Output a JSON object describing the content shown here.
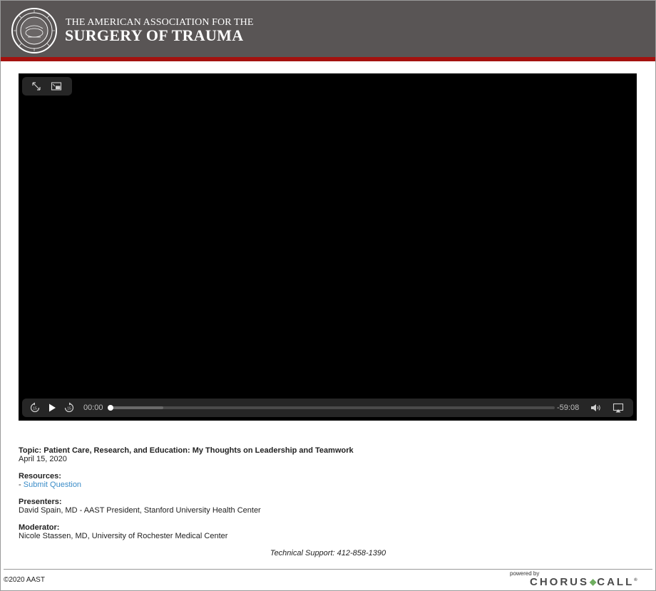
{
  "header": {
    "title_line1": "THE AMERICAN ASSOCIATION FOR THE",
    "title_line2": "SURGERY OF TRAUMA",
    "bg_color": "#595555",
    "stripe_color": "#a3120f"
  },
  "player": {
    "current_time": "00:00",
    "remaining_time": "-59:08",
    "progress": 0,
    "buffered": 0.12,
    "icons": [
      "expand-icon",
      "picture-in-picture-icon",
      "skip-back-icon",
      "play-icon",
      "skip-forward-icon",
      "volume-icon",
      "airplay-icon"
    ]
  },
  "info": {
    "topic_label": "Topic:",
    "topic": "Patient Care, Research, and Education: My Thoughts on Leadership and Teamwork",
    "date": "April 15, 2020",
    "resources_label": "Resources:",
    "resource_prefix": "- ",
    "submit_question": "Submit Question",
    "presenters_label": "Presenters:",
    "presenter": "David Spain, MD - AAST President, Stanford University Health Center",
    "moderator_label": "Moderator:",
    "moderator": "Nicole Stassen, MD, University of Rochester Medical Center"
  },
  "support": "Technical Support: 412-858-1390",
  "footer": {
    "copyright": "©2020 AAST",
    "powered_by": "powered by",
    "brand_left": "CHORUS",
    "brand_right": "CALL",
    "brand_mark": "®",
    "link_color": "#3a8cc8"
  }
}
